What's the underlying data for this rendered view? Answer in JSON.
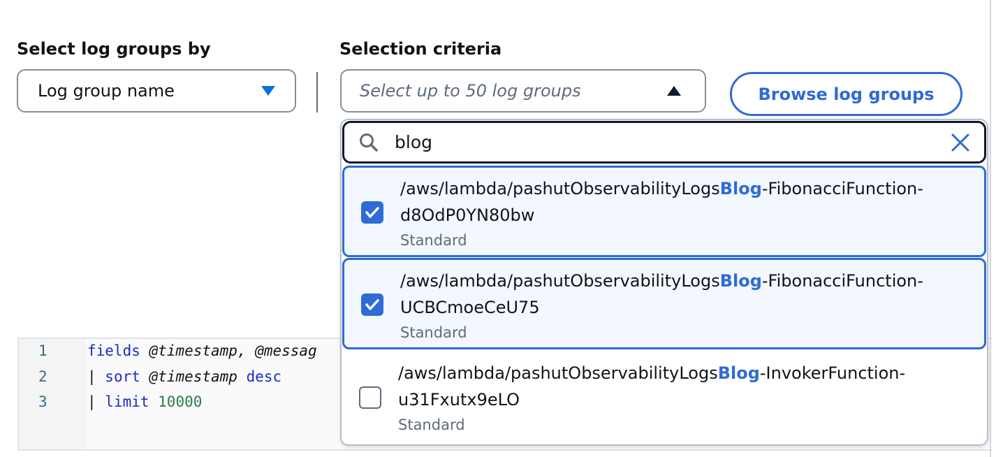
{
  "select_by": {
    "label": "Select log groups by",
    "value": "Log group name"
  },
  "criteria": {
    "label": "Selection criteria",
    "placeholder": "Select up to 50 log groups"
  },
  "browse_label": "Browse log groups",
  "search": {
    "value": "blog"
  },
  "options": [
    {
      "prefix": "/aws/lambda/pashutObservabilityLogs",
      "match": "Blog",
      "suffix": "-FibonacciFunction-",
      "line2": "d8OdP0YN80bw",
      "type": "Standard",
      "checked": true
    },
    {
      "prefix": "/aws/lambda/pashutObservabilityLogs",
      "match": "Blog",
      "suffix": "-FibonacciFunction-",
      "line2": "UCBCmoeCeU75",
      "type": "Standard",
      "checked": true
    },
    {
      "prefix": "/aws/lambda/pashutObservabilityLogs",
      "match": "Blog",
      "suffix": "-InvokerFunction-",
      "line2": "u31Fxutx9eLO",
      "type": "Standard",
      "checked": false
    }
  ],
  "editor": {
    "lines": [
      {
        "n": "1",
        "kw": "fields",
        "rest": " @timestamp, @messag"
      },
      {
        "n": "2",
        "pre": "| ",
        "kw": "sort",
        "rest": " @timestamp ",
        "kw2": "desc"
      },
      {
        "n": "3",
        "pre": "| ",
        "kw": "limit",
        "num": " 10000"
      }
    ]
  },
  "colors": {
    "accent": "#2f6bd6",
    "selected_bg": "#f2f8fd"
  }
}
